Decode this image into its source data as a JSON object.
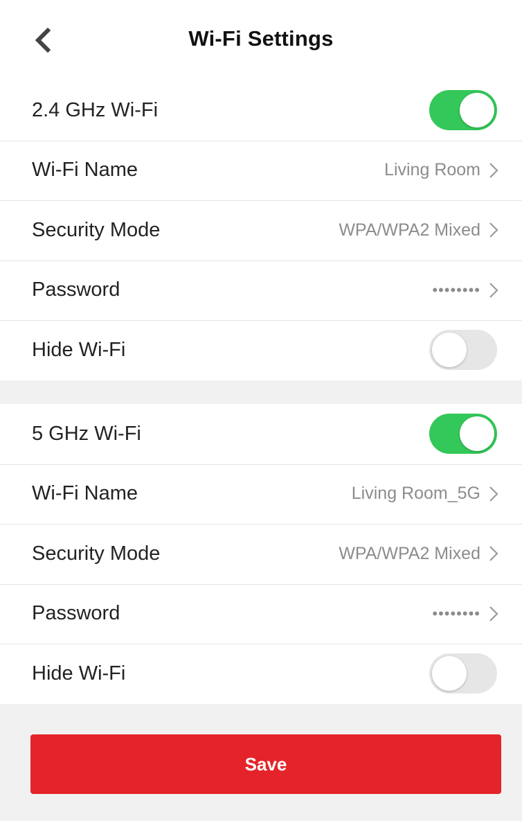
{
  "header": {
    "title": "Wi-Fi Settings",
    "back_icon": "back-chevron-icon"
  },
  "band_24": {
    "label": "2.4 GHz Wi-Fi",
    "enabled": true,
    "wifi_name_label": "Wi-Fi Name",
    "wifi_name_value": "Living Room",
    "security_label": "Security Mode",
    "security_value": "WPA/WPA2 Mixed",
    "password_label": "Password",
    "password_value": "••••••••",
    "hide_label": "Hide Wi-Fi",
    "hide_enabled": false
  },
  "band_5": {
    "label": "5 GHz Wi-Fi",
    "enabled": true,
    "wifi_name_label": "Wi-Fi Name",
    "wifi_name_value": "Living Room_5G",
    "security_label": "Security Mode",
    "security_value": "WPA/WPA2 Mixed",
    "password_label": "Password",
    "password_value": "••••••••",
    "hide_label": "Hide Wi-Fi",
    "hide_enabled": false
  },
  "actions": {
    "save_label": "Save"
  },
  "colors": {
    "toggle_on": "#34c759",
    "toggle_off": "#e6e6e6",
    "save_button": "#e5232a",
    "value_text": "#8c8c8c",
    "background": "#f1f1f1"
  }
}
